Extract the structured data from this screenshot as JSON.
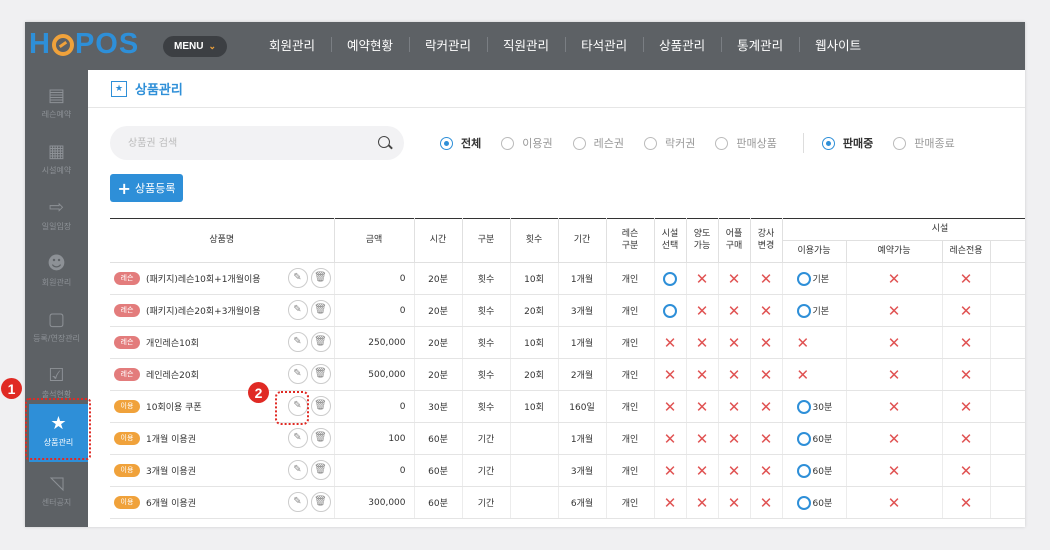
{
  "logo": {
    "left": "H",
    "right": "POS"
  },
  "header": {
    "menu_label": "MENU",
    "nav": [
      "회원관리",
      "예약현황",
      "락커관리",
      "직원관리",
      "타석관리",
      "상품관리",
      "통계관리",
      "웹사이트"
    ]
  },
  "sidebar": {
    "items": [
      {
        "label": "레슨예약",
        "icon": "calendar-icon"
      },
      {
        "label": "시설예약",
        "icon": "building-icon"
      },
      {
        "label": "일일입장",
        "icon": "entry-icon"
      },
      {
        "label": "회원관리",
        "icon": "user-icon"
      },
      {
        "label": "등록/연장관리",
        "icon": "register-icon"
      },
      {
        "label": "출석현황",
        "icon": "attendance-icon"
      },
      {
        "label": "상품관리",
        "icon": "product-icon",
        "active": true
      },
      {
        "label": "센터공지",
        "icon": "megaphone-icon"
      }
    ]
  },
  "page": {
    "title": "상품관리"
  },
  "search": {
    "placeholder": "상품권 검색"
  },
  "filters": {
    "type": [
      {
        "label": "전체",
        "selected": true
      },
      {
        "label": "이용권",
        "selected": false
      },
      {
        "label": "레슨권",
        "selected": false
      },
      {
        "label": "락커권",
        "selected": false
      },
      {
        "label": "판매상품",
        "selected": false
      }
    ],
    "status": [
      {
        "label": "판매중",
        "selected": true
      },
      {
        "label": "판매종료",
        "selected": false
      }
    ]
  },
  "add_button": {
    "label": "상품등록"
  },
  "table": {
    "headers": {
      "name": "상품명",
      "price": "금액",
      "time": "시간",
      "kind": "구분",
      "count": "횟수",
      "period": "기간",
      "lesson_kind": [
        "레슨",
        "구분"
      ],
      "facility_select": [
        "시설",
        "선택"
      ],
      "transfer": [
        "양도",
        "가능"
      ],
      "extra": [
        "어플",
        "구매"
      ],
      "coach_change": [
        "강사",
        "변경"
      ],
      "facility": "시설",
      "facility_use": "이용가능",
      "facility_reserve": "예약가능",
      "facility_lesson": "레슨전용"
    },
    "rows": [
      {
        "badge": "레슨",
        "badge_type": "lesson",
        "name": "(패키지)레슨10회+1개월이용",
        "price": "0",
        "time": "20분",
        "kind": "횟수",
        "count": "10회",
        "period": "1개월",
        "lesson_kind": "개인",
        "facility_select": "O",
        "transfer": "X",
        "extra": "X",
        "coach_change": "X",
        "use": "O",
        "use_text": "기본",
        "reserve": "X",
        "lesson": "X"
      },
      {
        "badge": "레슨",
        "badge_type": "lesson",
        "name": "(패키지)레슨20회+3개월이용",
        "price": "0",
        "time": "20분",
        "kind": "횟수",
        "count": "20회",
        "period": "3개월",
        "lesson_kind": "개인",
        "facility_select": "O",
        "transfer": "X",
        "extra": "X",
        "coach_change": "X",
        "use": "O",
        "use_text": "기본",
        "reserve": "X",
        "lesson": "X"
      },
      {
        "badge": "레슨",
        "badge_type": "lesson",
        "name": "개인레슨10회",
        "price": "250,000",
        "time": "20분",
        "kind": "횟수",
        "count": "10회",
        "period": "1개월",
        "lesson_kind": "개인",
        "facility_select": "X",
        "transfer": "X",
        "extra": "X",
        "coach_change": "X",
        "use": "X",
        "use_text": "",
        "reserve": "X",
        "lesson": "X"
      },
      {
        "badge": "레슨",
        "badge_type": "lesson",
        "name": "레인레슨20회",
        "price": "500,000",
        "time": "20분",
        "kind": "횟수",
        "count": "20회",
        "period": "2개월",
        "lesson_kind": "개인",
        "facility_select": "X",
        "transfer": "X",
        "extra": "X",
        "coach_change": "X",
        "use": "X",
        "use_text": "",
        "reserve": "X",
        "lesson": "X"
      },
      {
        "badge": "이용",
        "badge_type": "usage",
        "name": "10회이용 쿠폰",
        "price": "0",
        "time": "30분",
        "kind": "횟수",
        "count": "10회",
        "period": "160일",
        "lesson_kind": "개인",
        "facility_select": "X",
        "transfer": "X",
        "extra": "X",
        "coach_change": "X",
        "use": "O",
        "use_text": "30분",
        "reserve": "X",
        "lesson": "X"
      },
      {
        "badge": "이용",
        "badge_type": "usage",
        "name": "1개월 이용권",
        "price": "100",
        "time": "60분",
        "kind": "기간",
        "count": "",
        "period": "1개월",
        "lesson_kind": "개인",
        "facility_select": "X",
        "transfer": "X",
        "extra": "X",
        "coach_change": "X",
        "use": "O",
        "use_text": "60분",
        "reserve": "X",
        "lesson": "X"
      },
      {
        "badge": "이용",
        "badge_type": "usage",
        "name": "3개월 이용권",
        "price": "0",
        "time": "60분",
        "kind": "기간",
        "count": "",
        "period": "3개월",
        "lesson_kind": "개인",
        "facility_select": "X",
        "transfer": "X",
        "extra": "X",
        "coach_change": "X",
        "use": "O",
        "use_text": "60분",
        "reserve": "X",
        "lesson": "X"
      },
      {
        "badge": "이용",
        "badge_type": "usage",
        "name": "6개월 이용권",
        "price": "300,000",
        "time": "60분",
        "kind": "기간",
        "count": "",
        "period": "6개월",
        "lesson_kind": "개인",
        "facility_select": "X",
        "transfer": "X",
        "extra": "X",
        "coach_change": "X",
        "use": "O",
        "use_text": "60분",
        "reserve": "X",
        "lesson": "X"
      }
    ]
  },
  "callouts": [
    "1",
    "2"
  ],
  "colors": {
    "accent": "#2e8fd8",
    "topbar": "#5d6165",
    "x_mark": "#e05353",
    "callout": "#e02a24"
  }
}
